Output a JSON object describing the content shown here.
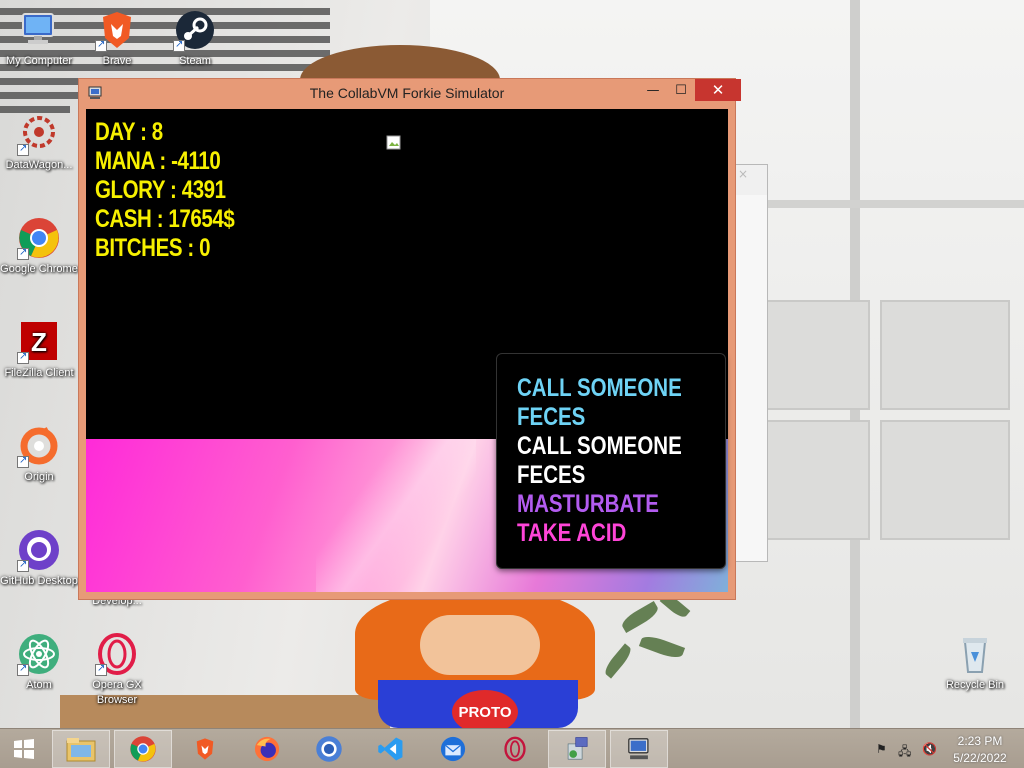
{
  "desktop": {
    "icons": [
      {
        "label": "My Computer",
        "icon": "computer-icon"
      },
      {
        "label": "Brave",
        "icon": "brave-icon"
      },
      {
        "label": "Steam",
        "icon": "steam-icon"
      },
      {
        "label": "DataWagon...",
        "icon": "datawagon-icon"
      },
      {
        "label": "Google Chrome",
        "icon": "chrome-icon"
      },
      {
        "label": "FileZilla Client",
        "icon": "filezilla-icon"
      },
      {
        "label": "Origin",
        "icon": "origin-icon"
      },
      {
        "label": "GitHub Desktop",
        "icon": "github-icon"
      },
      {
        "label": "Develop...",
        "icon": "develop-icon"
      },
      {
        "label": "Atom",
        "icon": "atom-icon"
      },
      {
        "label": "Opera GX Browser",
        "icon": "opera-gx-icon"
      },
      {
        "label": "Recycle Bin",
        "icon": "recycle-bin-icon"
      }
    ],
    "wallpaper_badge": "PROTO"
  },
  "window": {
    "title": "The CollabVM Forkie Simulator",
    "close_glyph": "✕",
    "max_glyph": "☐",
    "min_glyph": "—"
  },
  "game": {
    "stats": [
      "DAY : 8",
      "MANA : -4110",
      "GLORY : 4391",
      "CASH : 17654$",
      "BITCHES : 0"
    ],
    "menu": [
      {
        "label": "CALL SOMEONE",
        "color": "#6ed3f5"
      },
      {
        "label": "FECES",
        "color": "#6ed3f5"
      },
      {
        "label": "CALL SOMEONE",
        "color": "#ffffff"
      },
      {
        "label": "FECES",
        "color": "#ffffff"
      },
      {
        "label": "MASTURBATE",
        "color": "#b35cf0"
      },
      {
        "label": "TAKE ACID",
        "color": "#ff45d8"
      }
    ],
    "stat_color": "#f7f000"
  },
  "taskbar": {
    "apps": [
      "file-explorer-icon",
      "chrome-icon",
      "brave-icon",
      "firefox-icon",
      "chromium-icon",
      "vs-code-icon",
      "thunderbird-icon",
      "opera-icon",
      "install-icon",
      "computer-icon"
    ],
    "clock_time": "2:23 PM",
    "clock_date": "5/22/2022"
  },
  "colors": {
    "titlebar": "#e79a77",
    "close": "#c7352f"
  }
}
